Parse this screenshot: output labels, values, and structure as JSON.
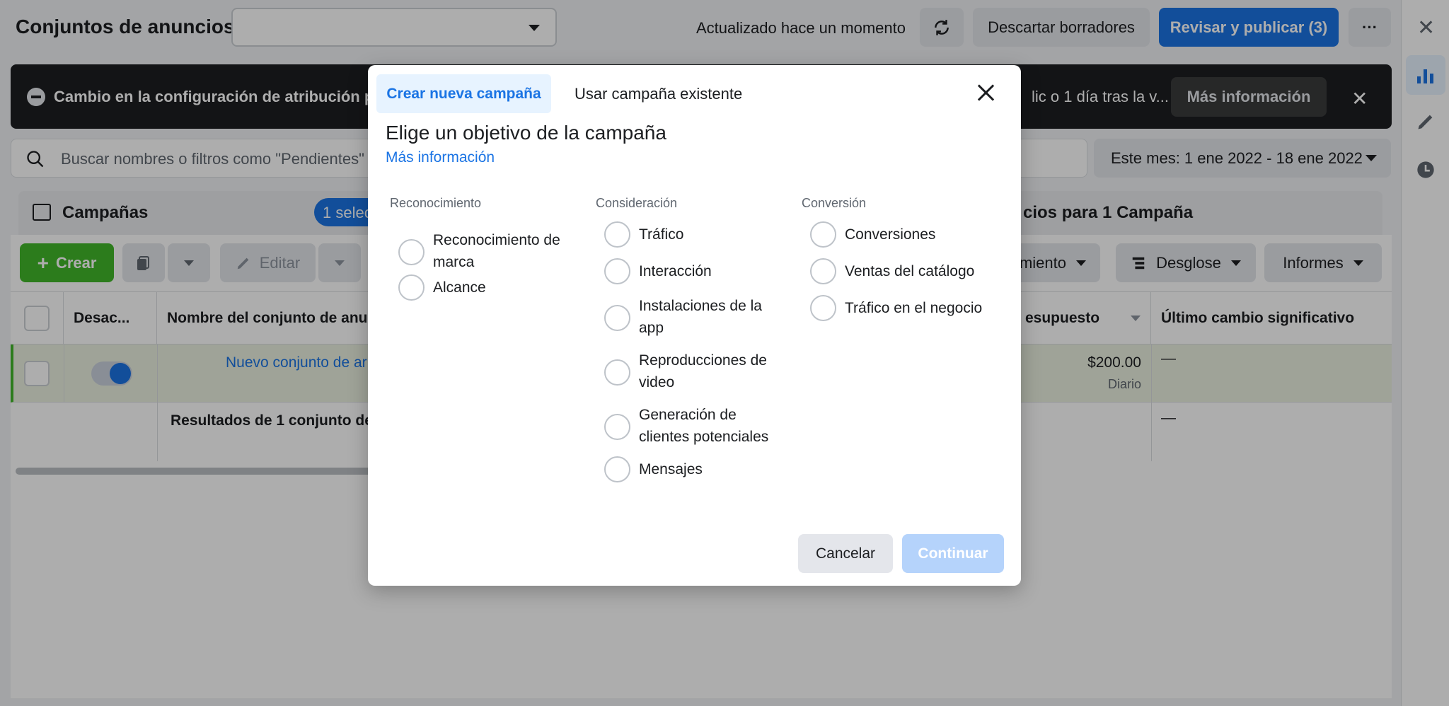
{
  "page": {
    "title": "Conjuntos de anuncios",
    "updated": "Actualizado hace un momento",
    "discard_label": "Descartar borradores",
    "publish_label": "Revisar y publicar (3)",
    "more_label": "···"
  },
  "banner": {
    "text": "Cambio en la configuración de atribución pred",
    "text_right": "lic o 1 día tras la v...",
    "more_info": "Más información"
  },
  "search": {
    "placeholder": "Buscar nombres o filtros como \"Pendientes\"",
    "date_range": "Este mes: 1 ene 2022 - 18 ene 2022"
  },
  "tabs_strip": {
    "campaigns": "Campañas",
    "selected": "1 selec",
    "right": "cios para 1 Campaña"
  },
  "toolbar": {
    "create": "Crear",
    "edit": "Editar",
    "rendimiento": "miento",
    "desglose": "Desglose",
    "informes": "Informes"
  },
  "table": {
    "headers": {
      "desac": "Desac...",
      "name": "Nombre del conjunto de anun",
      "budget": "esupuesto",
      "last_change": "Último cambio significativo"
    },
    "row": {
      "name": "Nuevo conjunto de ar",
      "budget": "$200.00",
      "budget_type": "Diario",
      "last_change": "—"
    },
    "summary": {
      "label": "Resultados de 1 conjunto de",
      "last_change": "—"
    }
  },
  "modal": {
    "tab_new": "Crear nueva campaña",
    "tab_existing": "Usar campaña existente",
    "heading": "Elige un objetivo de la campaña",
    "learn_more": "Más información",
    "columns": [
      {
        "title": "Reconocimiento",
        "options": [
          "Reconocimiento de marca",
          "Alcance"
        ]
      },
      {
        "title": "Consideración",
        "options": [
          "Tráfico",
          "Interacción",
          "Instalaciones de la app",
          "Reproducciones de video",
          "Generación de clientes potenciales",
          "Mensajes"
        ]
      },
      {
        "title": "Conversión",
        "options": [
          "Conversiones",
          "Ventas del catálogo",
          "Tráfico en el negocio"
        ]
      }
    ],
    "cancel": "Cancelar",
    "continue": "Continuar"
  },
  "colors": {
    "accent": "#1b74e4",
    "create_green": "#42b72a",
    "continue_disabled": "#b5d3fb"
  }
}
